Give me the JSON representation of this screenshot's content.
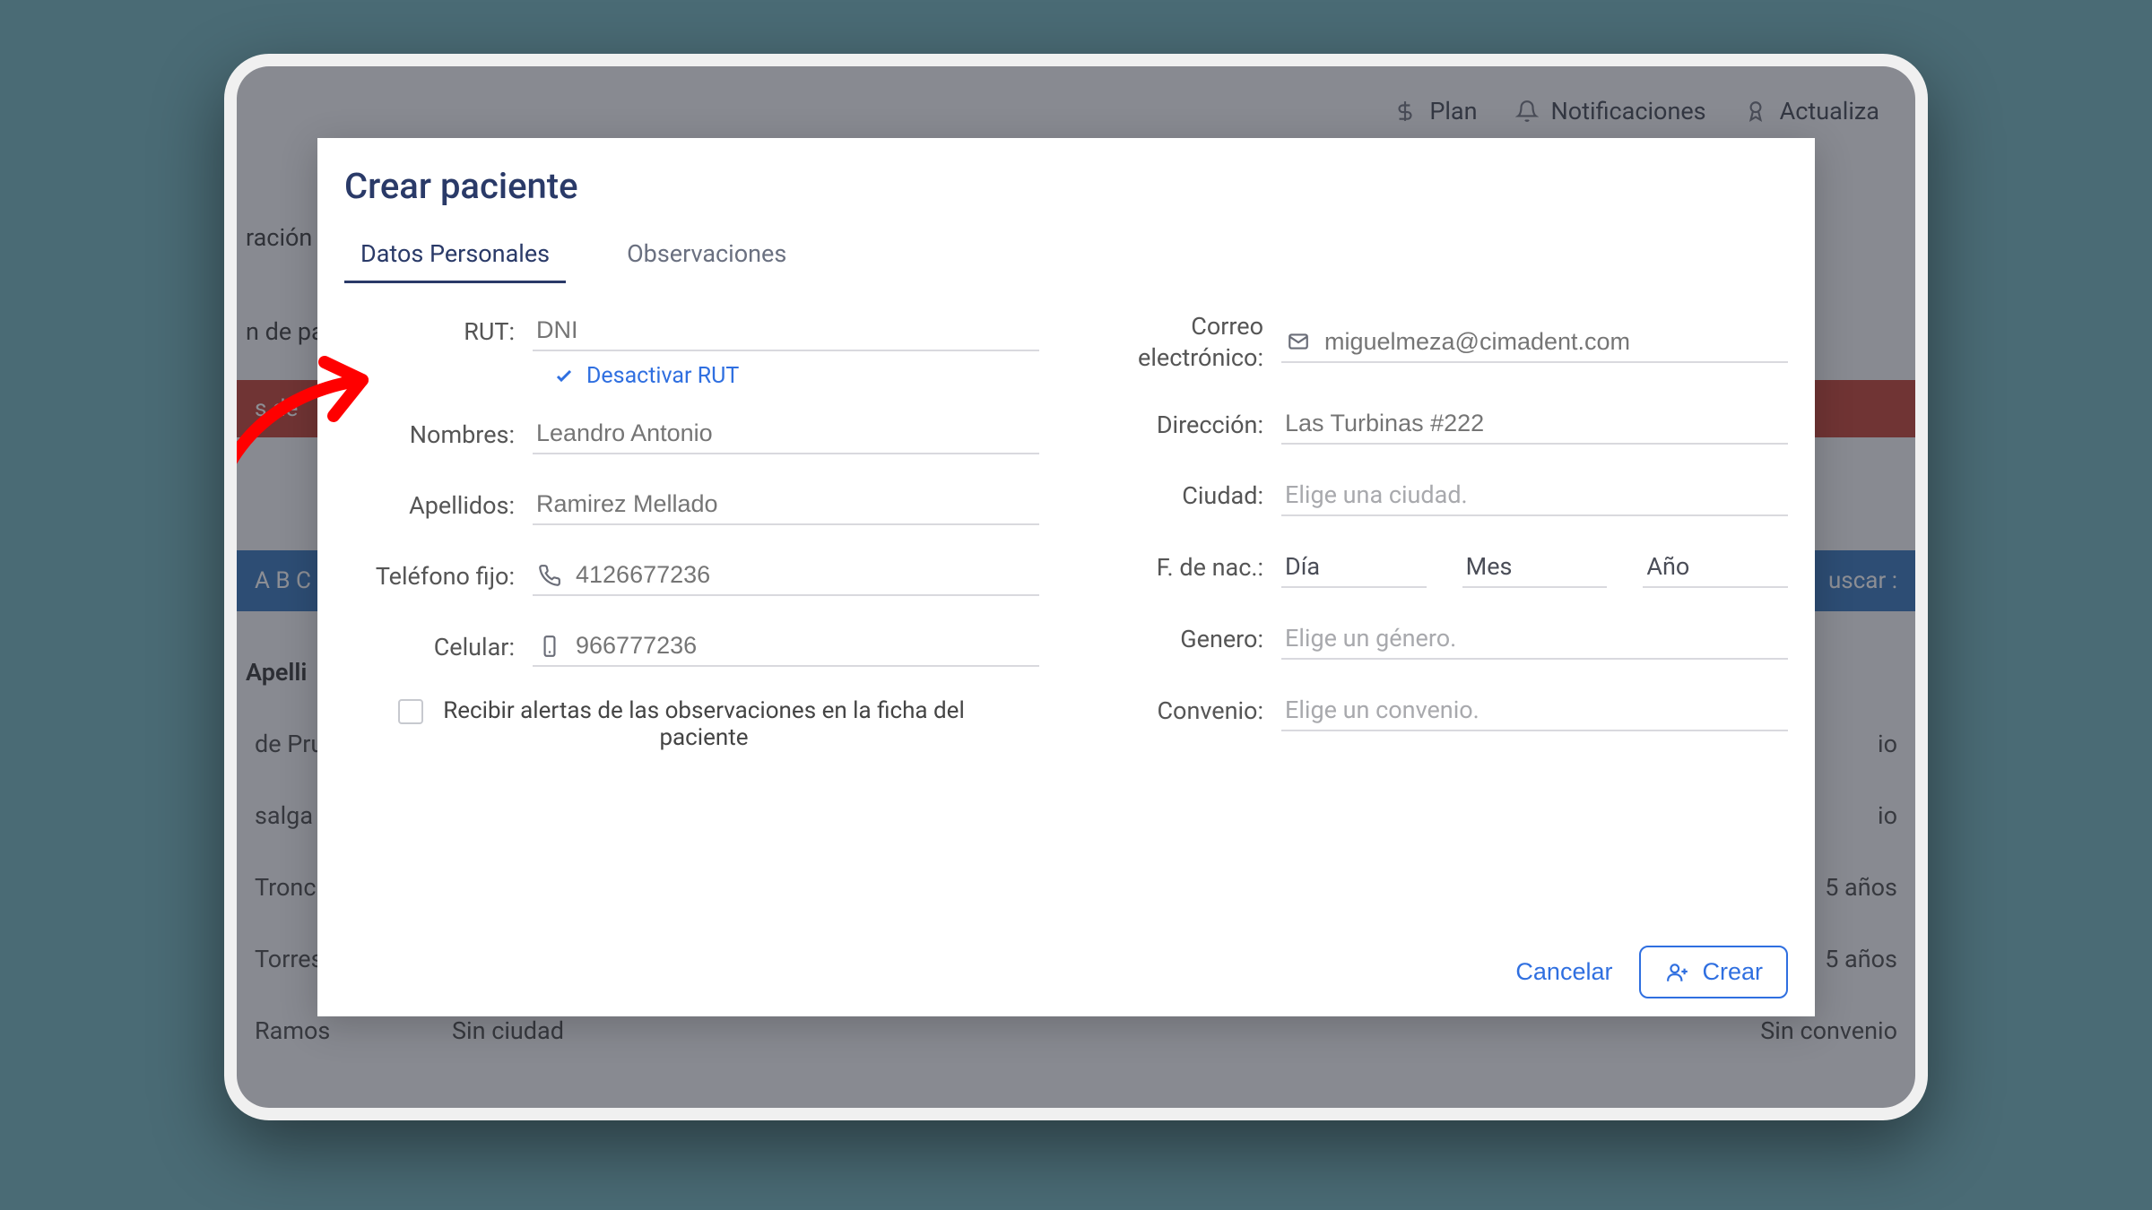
{
  "topbar": {
    "plan": "Plan",
    "notifications": "Notificaciones",
    "updates": "Actualiza"
  },
  "background": {
    "nav1": "ración",
    "nav2": "n de pa",
    "red_row": "s de",
    "blue_left": "A B C D",
    "blue_right": "uscar :",
    "table_header": "Apelli",
    "rows": [
      {
        "left": "de Pru",
        "mid": "",
        "right": "io"
      },
      {
        "left": "salga",
        "mid": "",
        "right": "io"
      },
      {
        "left": "Tronc",
        "mid": "",
        "right": "5 años"
      },
      {
        "left": "Torres",
        "mid": "",
        "right": "5 años"
      },
      {
        "left": "Ramos",
        "mid": "Sin ciudad",
        "right": "Sin convenio"
      }
    ]
  },
  "modal": {
    "title": "Crear paciente",
    "tabs": {
      "personal": "Datos Personales",
      "observations": "Observaciones"
    },
    "labels": {
      "rut": "RUT:",
      "deactivate_rut": "Desactivar RUT",
      "names": "Nombres:",
      "surnames": "Apellidos:",
      "landline": "Teléfono fijo:",
      "mobile": "Celular:",
      "alerts": "Recibir alertas de las observaciones en la ficha del paciente",
      "email": "Correo electrónico:",
      "address": "Dirección:",
      "city": "Ciudad:",
      "dob": "F. de nac.:",
      "day": "Día",
      "month": "Mes",
      "year": "Año",
      "gender": "Genero:",
      "agreement": "Convenio:"
    },
    "placeholders": {
      "rut": "DNI",
      "names": "Leandro Antonio",
      "surnames": "Ramirez Mellado",
      "landline": "4126677236",
      "mobile": "966777236",
      "email": "miguelmeza@cimadent.com",
      "address": "Las Turbinas #222",
      "city": "Elige una ciudad.",
      "gender": "Elige un género.",
      "agreement": "Elige un convenio."
    },
    "actions": {
      "cancel": "Cancelar",
      "create": "Crear"
    }
  }
}
